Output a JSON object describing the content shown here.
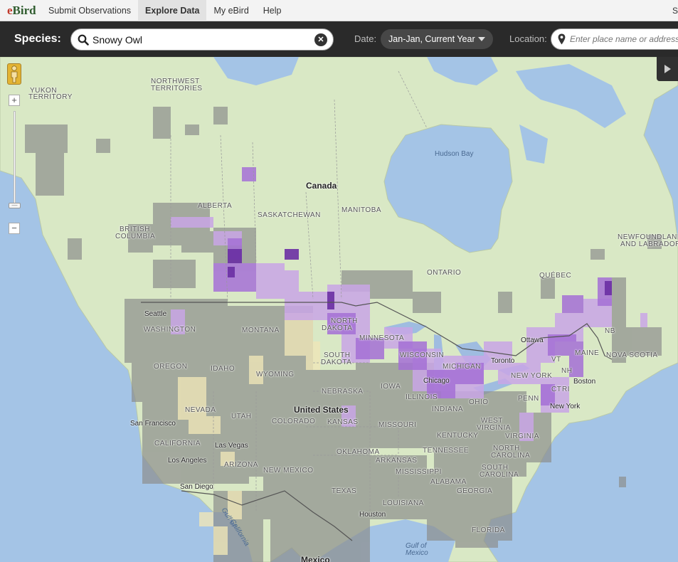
{
  "nav": {
    "logo_e": "e",
    "logo_rest": "Bird",
    "items": [
      "Submit Observations",
      "Explore Data",
      "My eBird",
      "Help"
    ],
    "right_text": "S"
  },
  "toolbar": {
    "species_label": "Species:",
    "species_value": "Snowy Owl",
    "date_label": "Date:",
    "date_value": "Jan-Jan, Current Year",
    "location_label": "Location:",
    "location_placeholder": "Enter place name or address"
  },
  "map": {
    "countries": [
      "Canada",
      "United States",
      "Mexico"
    ],
    "regions": [
      "YUKON",
      "TERRITORY",
      "NORTHWEST",
      "TERRITORIES",
      "BRITISH",
      "COLUMBIA",
      "ALBERTA",
      "SASKATCHEWAN",
      "MANITOBA",
      "ONTARIO",
      "QUÉBEC",
      "NEWFOUNDLAND",
      "AND LABRADOR",
      "WASHINGTON",
      "OREGON",
      "IDAHO",
      "MONTANA",
      "WYOMING",
      "NORTH",
      "DAKOTA",
      "SOUTH",
      "DAKOTA",
      "NEBRASKA",
      "MINNESOTA",
      "WISCONSIN",
      "MICHIGAN",
      "IOWA",
      "ILLINOIS",
      "INDIANA",
      "OHIO",
      "PENN",
      "NEW YORK",
      "MAINE",
      "NB",
      "NOVA SCOTIA",
      "CALIFORNIA",
      "NEVADA",
      "UTAH",
      "COLORADO",
      "KANSAS",
      "MISSOURI",
      "KENTUCKY",
      "WEST",
      "VIRGINIA",
      "VIRGINIA",
      "ARIZONA",
      "NEW MEXICO",
      "OKLAHOMA",
      "ARKANSAS",
      "TENNESSEE",
      "NORTH",
      "CAROLINA",
      "SOUTH",
      "CAROLINA",
      "MISSISSIPPI",
      "ALABAMA",
      "GEORGIA",
      "TEXAS",
      "LOUISIANA",
      "FLORIDA",
      "VT",
      "NH",
      "CT",
      "RI"
    ],
    "cities": [
      "Seattle",
      "San Francisco",
      "Las Vegas",
      "Los Angeles",
      "San Diego",
      "Houston",
      "Chicago",
      "Toronto",
      "Ottawa",
      "Boston",
      "New York"
    ],
    "water": [
      "Hudson Bay",
      "Gulf of",
      "Mexico",
      "Gulf of",
      "California"
    ],
    "zoom_in": "+",
    "zoom_out": "−"
  },
  "colors": {
    "nav_bg": "#f3f3f3",
    "toolbar_bg": "#2a2a2a",
    "ocean": "#a4c4e6",
    "land": "#d9e8c5",
    "freq_low": "#c9a6e6",
    "freq_mid": "#a570d6",
    "freq_high": "#6a2fa3",
    "no_data": "#8d8f8d"
  }
}
